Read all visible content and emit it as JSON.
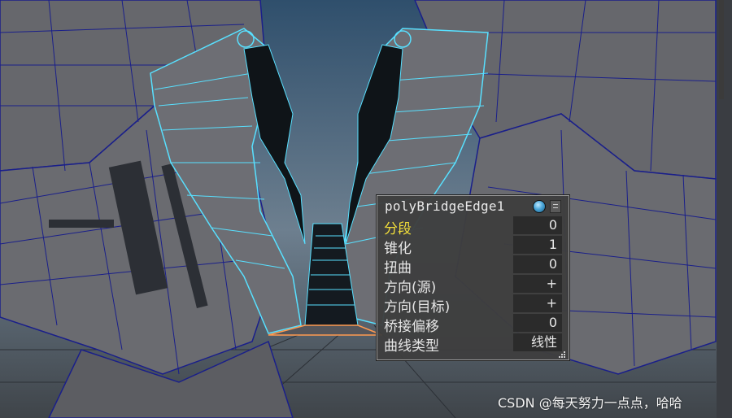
{
  "viewport": {
    "colors": {
      "background_top": "#3e5e78",
      "background_bottom": "#9aa4ad",
      "mesh_fill": "#6b6b70",
      "mesh_wire": "#1a1f8a",
      "selected_wire": "#58e0ff",
      "bridge_edge": "#ff9a50"
    }
  },
  "hud": {
    "title": "polyBridgeEdge1",
    "icons": [
      "node-state-icon",
      "menu-icon"
    ],
    "attributes": [
      {
        "label": "分段",
        "value": "0",
        "active": true
      },
      {
        "label": "锥化",
        "value": "1",
        "active": false
      },
      {
        "label": "扭曲",
        "value": "0",
        "active": false
      },
      {
        "label": "方向(源)",
        "value": "+",
        "active": false
      },
      {
        "label": "方向(目标)",
        "value": "+",
        "active": false
      },
      {
        "label": "桥接偏移",
        "value": "0",
        "active": false
      },
      {
        "label": "曲线类型",
        "value": "线性",
        "active": false
      }
    ],
    "colors": {
      "active_label": "#f2de3a",
      "label": "#e6e6e6",
      "field_bg": "#2b2b2b"
    }
  },
  "watermark": {
    "text": "CSDN @每天努力一点点，哈哈"
  }
}
